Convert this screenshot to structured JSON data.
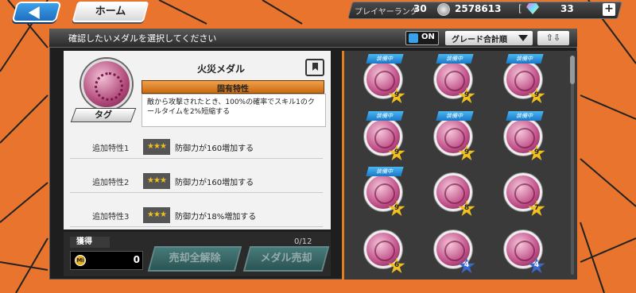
{
  "topbar": {
    "home_label": "ホーム",
    "player_rank_label": "プレイヤーランク",
    "player_rank": "30",
    "coins": "2578613",
    "gem_bracket": "[",
    "gems": "33",
    "plus": "+"
  },
  "header": {
    "instruction": "確認したいメダルを選択してください",
    "on_label": "ON",
    "sort_label": "グレード合計順",
    "order_label": "⇧⇩"
  },
  "medal": {
    "name": "火災メダル",
    "tag_label": "タグ",
    "unique_trait_label": "固有特性",
    "unique_trait_desc": "敵から攻撃されたとき、100%の確率でスキル1のクールタイムを2%短縮する",
    "extra_traits": [
      {
        "name": "追加特性1",
        "stars": "★★★",
        "desc": "防御力が160増加する"
      },
      {
        "name": "追加特性2",
        "stars": "★★★",
        "desc": "防御力が160増加する"
      },
      {
        "name": "追加特性3",
        "stars": "★★★",
        "desc": "防御力が18%増加する"
      }
    ]
  },
  "owned": {
    "label": "獲得",
    "coin_icon_text": "Mi",
    "value": "0",
    "count": "0/12"
  },
  "actions": {
    "release_all": "売却全解除",
    "sell": "メダル売却"
  },
  "grid": {
    "equip_label": "装備中",
    "medals": [
      {
        "equipped": true,
        "level": "9",
        "star": "gold"
      },
      {
        "equipped": true,
        "level": "9",
        "star": "gold"
      },
      {
        "equipped": true,
        "level": "9",
        "star": "gold"
      },
      {
        "equipped": true,
        "level": "9",
        "star": "gold"
      },
      {
        "equipped": true,
        "level": "9",
        "star": "gold"
      },
      {
        "equipped": true,
        "level": "9",
        "star": "gold"
      },
      {
        "equipped": true,
        "level": "9",
        "star": "gold"
      },
      {
        "equipped": false,
        "level": "8",
        "star": "gold"
      },
      {
        "equipped": false,
        "level": "7",
        "star": "gold"
      },
      {
        "equipped": false,
        "level": "6",
        "star": "gold"
      },
      {
        "equipped": false,
        "level": "4",
        "star": "blue"
      },
      {
        "equipped": false,
        "level": "4",
        "star": "blue"
      }
    ]
  }
}
